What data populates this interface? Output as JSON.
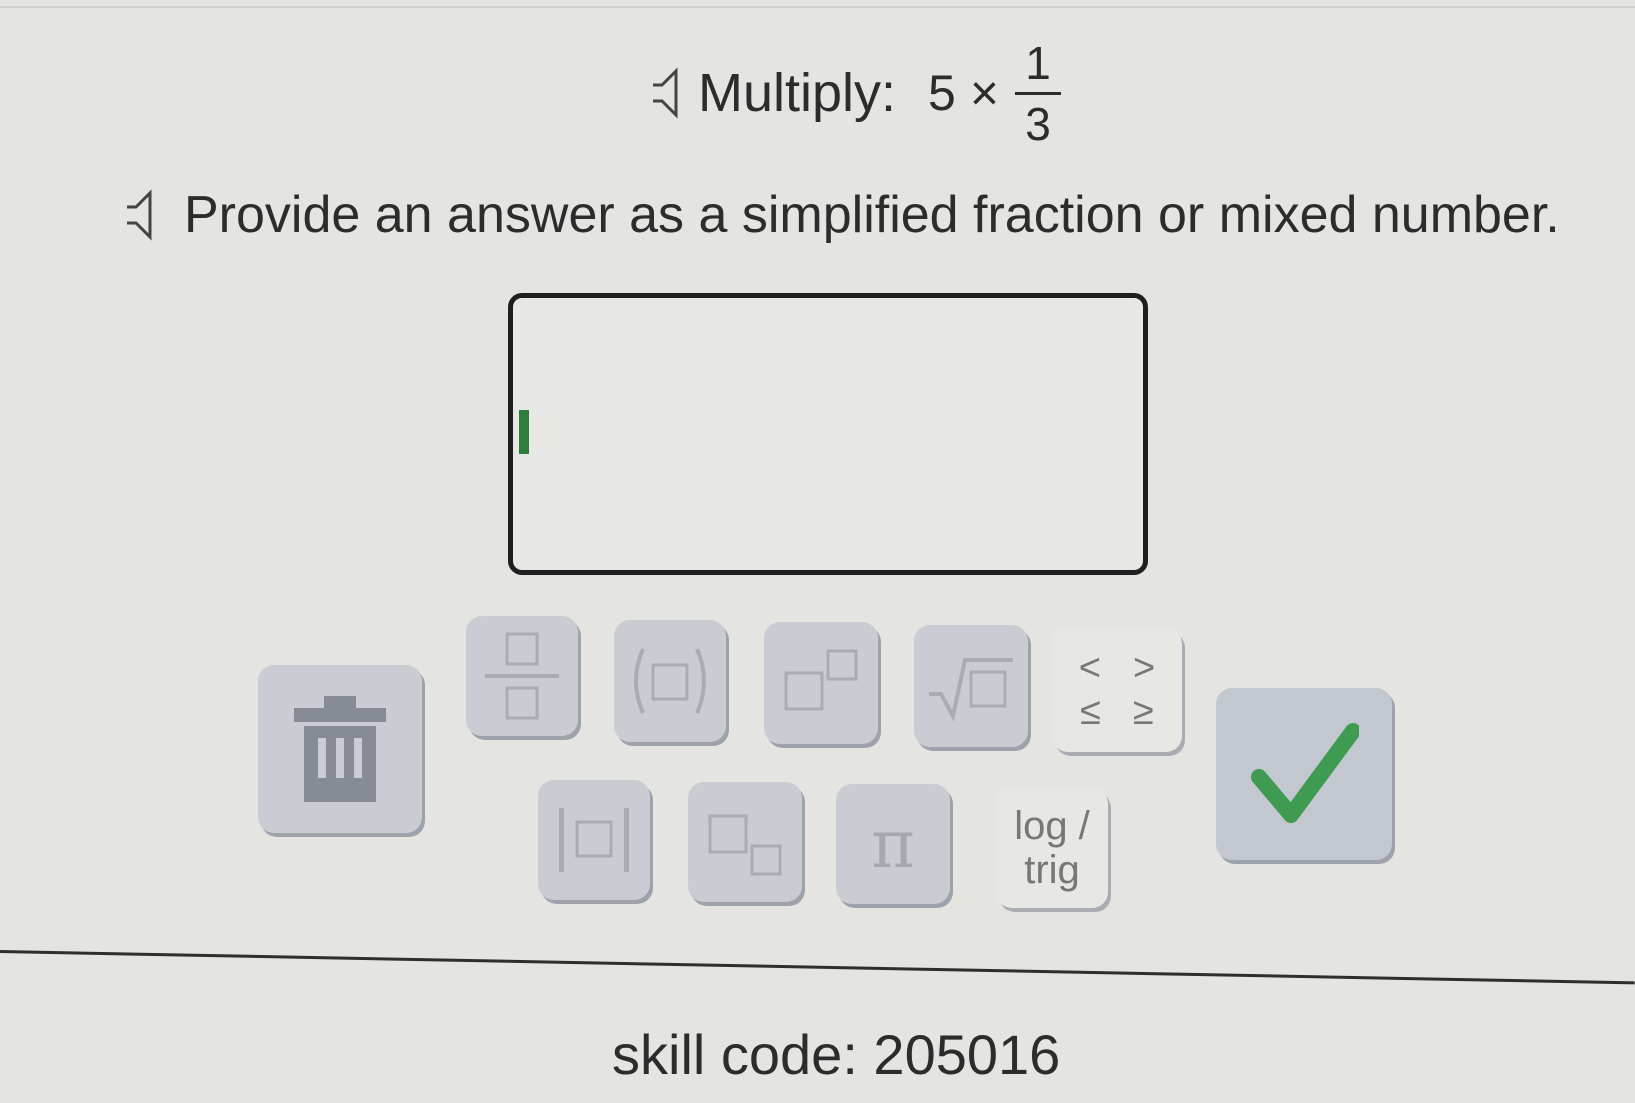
{
  "question": {
    "label": "Multiply:",
    "whole": "5",
    "operator": "×",
    "fraction": {
      "numerator": "1",
      "denominator": "3"
    }
  },
  "instruction": "Provide an answer as a simplified fraction or mixed number.",
  "answer": {
    "value": ""
  },
  "keypad": {
    "inequalities": [
      "<",
      ">",
      "≤",
      "≥"
    ],
    "pi": "π",
    "log_top": "log /",
    "log_bottom": "trig",
    "check_color": "#3f9a52"
  },
  "skill_code": "skill code: 205016"
}
